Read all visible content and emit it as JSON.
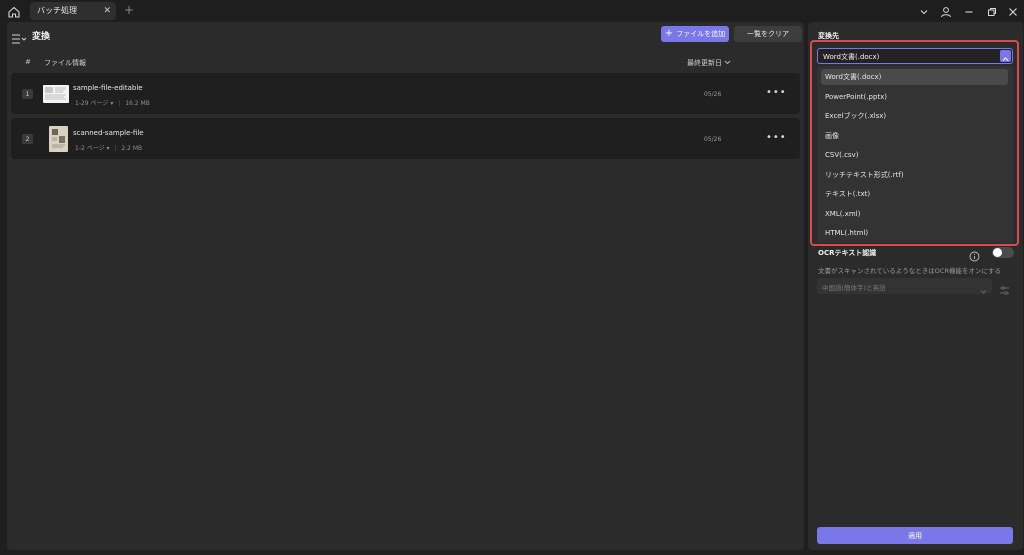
{
  "titlebar": {
    "tab_label": "バッチ処理",
    "tab_close": "✕",
    "tab_add": "+"
  },
  "toolbar": {
    "section_title": "変換",
    "add_button_icon": "+",
    "add_button_label": "ファイルを追加",
    "clear_button_label": "一覧をクリア"
  },
  "table": {
    "col_index": "#",
    "col_file": "ファイル情報",
    "col_date": "最終更新日",
    "rows": [
      {
        "index": "1",
        "name": "sample-file-editable",
        "pages": "1-29 ページ",
        "size": "16.2 MB",
        "date": "05/26",
        "more": "•••"
      },
      {
        "index": "2",
        "name": "scanned-sample-file",
        "pages": "1-2 ページ",
        "size": "2.2 MB",
        "date": "05/26",
        "more": "•••"
      }
    ]
  },
  "convert": {
    "title": "変換先",
    "selected": "Word文書(.docx)",
    "options": [
      "Word文書(.docx)",
      "PowerPoint(.pptx)",
      "Excelブック(.xlsx)",
      "画像",
      "CSV(.csv)",
      "リッチテキスト形式(.rtf)",
      "テキスト(.txt)",
      "XML(.xml)",
      "HTML(.html)"
    ]
  },
  "ocr": {
    "label": "OCRテキスト認識",
    "description": "文書がスキャンされているようなときはOCR機能をオンにする",
    "language": "中国語(簡体字)と英語",
    "enabled": false
  },
  "apply_label": "適用",
  "colors": {
    "accent": "#7a77e8",
    "highlight": "#d84c4f",
    "panel": "#2b2b2b",
    "background": "#1f1f1f"
  }
}
